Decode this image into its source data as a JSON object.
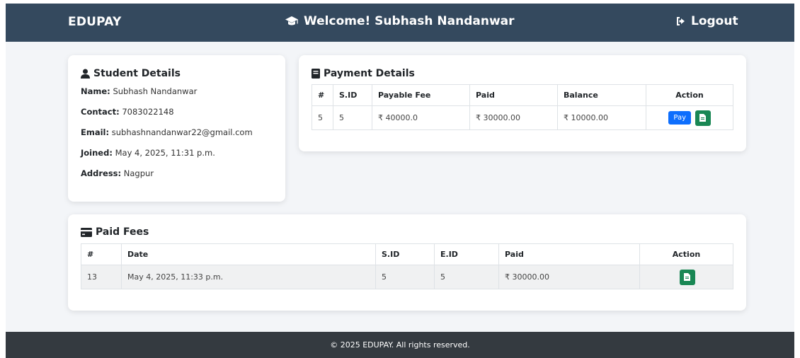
{
  "navbar": {
    "brand": "EDUPAY",
    "welcome": "Welcome! Subhash Nandanwar",
    "logout": "Logout",
    "icons": [
      "graduation-cap-icon",
      "sign-out-icon"
    ]
  },
  "student": {
    "title": "Student Details",
    "name_label": "Name:",
    "name": "Subhash Nandanwar",
    "contact_label": "Contact:",
    "contact": "7083022148",
    "email_label": "Email:",
    "email": "subhashnandanwar22@gmail.com",
    "joined_label": "Joined:",
    "joined": "May 4, 2025, 11:31 p.m.",
    "address_label": "Address:",
    "address": "Nagpur"
  },
  "payment": {
    "title": "Payment Details",
    "headers": [
      "#",
      "S.ID",
      "Payable Fee",
      "Paid",
      "Balance",
      "Action"
    ],
    "rows": [
      {
        "num": "5",
        "sid": "5",
        "payable": "₹ 40000.0",
        "paid": "₹ 30000.00",
        "balance": "₹ 10000.00",
        "pay_label": "Pay"
      }
    ]
  },
  "paid_fees": {
    "title": "Paid Fees",
    "headers": [
      "#",
      "Date",
      "S.ID",
      "E.ID",
      "Paid",
      "Action"
    ],
    "rows": [
      {
        "num": "13",
        "date": "May 4, 2025, 11:33 p.m.",
        "sid": "5",
        "eid": "5",
        "paid": "₹ 30000.00"
      }
    ]
  },
  "footer": {
    "text": "© 2025 EDUPAY. All rights reserved."
  },
  "colors": {
    "navbar": "#34495e",
    "footer": "#343a40",
    "pay_button": "#0d6efd",
    "doc_button": "#198754",
    "page_bg": "#f3f5f8"
  }
}
